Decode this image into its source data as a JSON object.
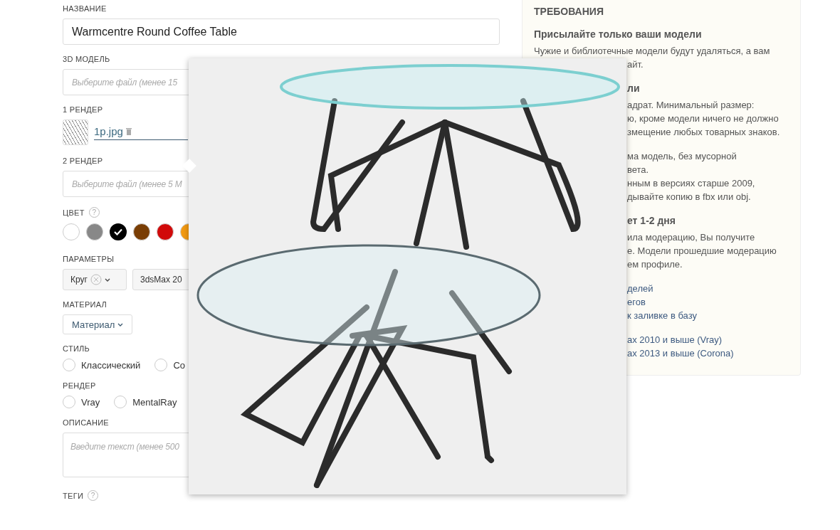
{
  "form": {
    "name": {
      "label": "НАЗВАНИЕ",
      "value": "Warmcentre Round Coffee Table"
    },
    "model": {
      "label": "3D МОДЕЛЬ",
      "placeholder": "Выберите файл (менее 15"
    },
    "render1": {
      "label": "1 РЕНДЕР",
      "file": "1p.jpg"
    },
    "render2": {
      "label": "2 РЕНДЕР",
      "placeholder": "Выберите файл (менее 5 М"
    },
    "color": {
      "label": "ЦВЕТ",
      "help": "?",
      "swatches": [
        {
          "color": "#ffffff",
          "selected": false
        },
        {
          "color": "#888888",
          "selected": false
        },
        {
          "color": "#000000",
          "selected": true
        },
        {
          "color": "#7a3e05",
          "selected": false
        },
        {
          "color": "#d10a0a",
          "selected": false
        },
        {
          "color": "#f39a12",
          "selected": false
        }
      ]
    },
    "params": {
      "label": "ПАРАМЕТРЫ",
      "chips": [
        {
          "text": "Круг",
          "removable": true
        },
        {
          "text": "3dsMax 20",
          "removable": false
        }
      ]
    },
    "material": {
      "label": "МАТЕРИАЛ",
      "button": "Материал"
    },
    "style": {
      "label": "СТИЛЬ",
      "options": [
        {
          "text": "Классический",
          "selected": false
        },
        {
          "text": "Co",
          "selected": false
        }
      ]
    },
    "render": {
      "label": "РЕНДЕР",
      "options": [
        {
          "text": "Vray",
          "selected": false
        },
        {
          "text": "MentalRay",
          "selected": false
        }
      ]
    },
    "description": {
      "label": "ОПИСАНИЕ",
      "placeholder": "Введите текст (менее 500"
    },
    "tags": {
      "label": "ТЕГИ",
      "help": "?"
    }
  },
  "requirements": {
    "title": "ТРЕБОВАНИЯ",
    "heading": "Присылайте только ваши модели",
    "intro": "Чужие и библиотечные модели будут удаляться, а вам",
    "groups": [
      [
        {
          "kind": "text",
          "text": "айт."
        }
      ],
      [
        {
          "kind": "heading",
          "text": "ли"
        },
        {
          "kind": "text",
          "text": "адрат. Минимальный размер:"
        },
        {
          "kind": "text",
          "text": "ю, кроме модели ничего не должно"
        },
        {
          "kind": "text",
          "text": "змещение любых товарных знаков."
        }
      ],
      [
        {
          "kind": "text",
          "text": "ма модель, без мусорной"
        },
        {
          "kind": "text",
          "text": "вета."
        },
        {
          "kind": "text",
          "text": "нным в версиях старше 2009,"
        },
        {
          "kind": "text",
          "text": "дывайте копию в fbx или obj."
        }
      ],
      [
        {
          "kind": "heading",
          "text": "ет 1-2 дня"
        },
        {
          "kind": "text",
          "text": "ила модерацию, Вы получите"
        },
        {
          "kind": "text",
          "text": "е. Модели прошедшие модерацию"
        },
        {
          "kind": "text",
          "text": "ем профиле."
        }
      ],
      [
        {
          "kind": "link",
          "text": "делей"
        },
        {
          "kind": "link",
          "text": "егов"
        },
        {
          "kind": "link",
          "text": "к заливке в базу"
        }
      ],
      [
        {
          "kind": "link",
          "text": "ах 2010 и выше (Vray)"
        },
        {
          "kind": "link",
          "text": "ах 2013 и выше (Corona)"
        }
      ]
    ]
  }
}
